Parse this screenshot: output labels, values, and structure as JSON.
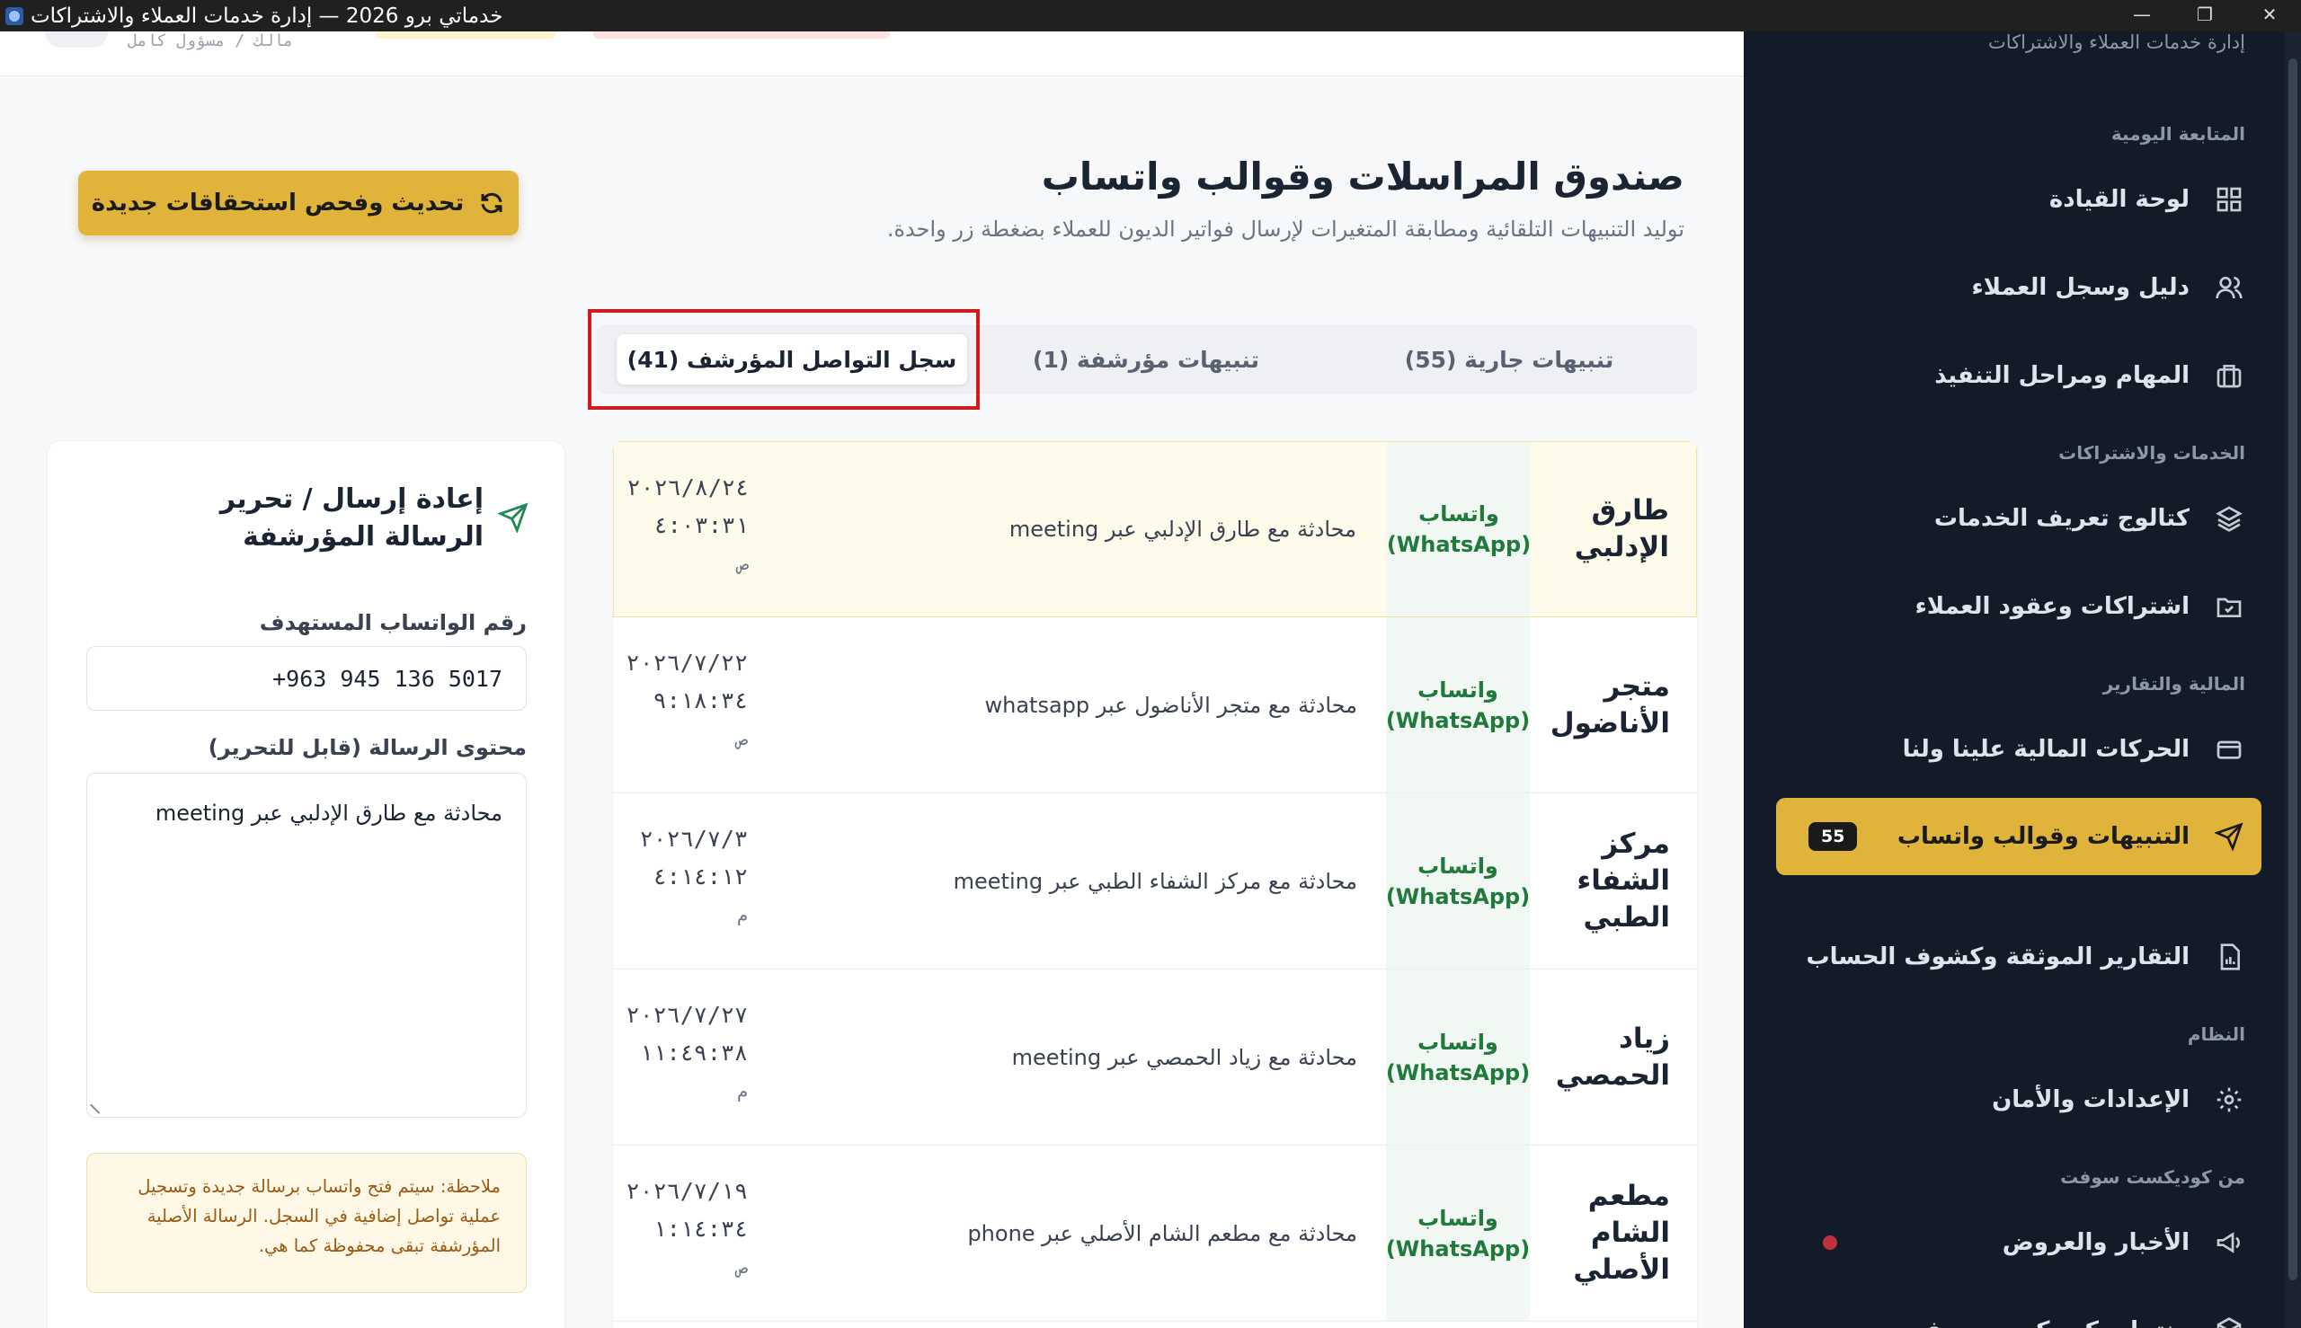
{
  "window": {
    "title": "خدماتي برو 2026 — إدارة خدمات العملاء والاشتراكات",
    "min": "—",
    "max": "❐",
    "close": "✕"
  },
  "topbar": {
    "role": "مالك / مسؤول كامل"
  },
  "sidebar": {
    "brand_sub": "إدارة خدمات العملاء والاشتراكات",
    "sections": {
      "daily": "المتابعة اليومية",
      "services": "الخدمات والاشتراكات",
      "finance": "المالية والتقارير",
      "system": "النظام",
      "vendor": "من كوديكست سوفت"
    },
    "items": [
      {
        "label": "لوحة القيادة",
        "icon": "dashboard-icon"
      },
      {
        "label": "دليل وسجل العملاء",
        "icon": "users-icon"
      },
      {
        "label": "المهام ومراحل التنفيذ",
        "icon": "briefcase-icon"
      },
      {
        "label": "كتالوج تعريف الخدمات",
        "icon": "layers-icon"
      },
      {
        "label": "اشتراكات وعقود العملاء",
        "icon": "folder-check-icon"
      },
      {
        "label": "الحركات المالية علينا ولنا",
        "icon": "card-icon"
      },
      {
        "label": "التنبيهات وقوالب واتساب",
        "icon": "send-icon",
        "badge": "55"
      },
      {
        "label": "التقارير الموثقة وكشوف الحساب",
        "icon": "report-icon"
      },
      {
        "label": "الإعدادات والأمان",
        "icon": "gear-icon"
      },
      {
        "label": "الأخبار والعروض",
        "icon": "megaphone-icon"
      },
      {
        "label": "منتجات كوديكست سوفت",
        "icon": "box-icon"
      }
    ]
  },
  "page": {
    "title": "صندوق المراسلات وقوالب واتساب",
    "subtitle": "توليد التنبيهات التلقائية ومطابقة المتغيرات لإرسال فواتير الديون للعملاء بضغطة زر واحدة.",
    "refresh_label": "تحديث وفحص استحقاقات جديدة"
  },
  "tabs": [
    {
      "label": "تنبيهات جارية (55)"
    },
    {
      "label": "تنبيهات مؤرشفة (1)"
    },
    {
      "label": "سجل التواصل المؤرشف (41)"
    }
  ],
  "log_rows": [
    {
      "name": "طارق الإدلبي",
      "channel": "واتساب (WhatsApp)",
      "summary": "محادثة مع طارق الإدلبي عبر meeting",
      "date": "٢٠٢٦/٨/٢٤",
      "time": "٤:٠٣:٣١",
      "ampm": "ص"
    },
    {
      "name": "متجر الأناضول",
      "channel": "واتساب (WhatsApp)",
      "summary": "محادثة مع متجر الأناضول عبر whatsapp",
      "date": "٢٠٢٦/٧/٢٢",
      "time": "٩:١٨:٣٤",
      "ampm": "ص"
    },
    {
      "name": "مركز الشفاء الطبي",
      "channel": "واتساب (WhatsApp)",
      "summary": "محادثة مع مركز الشفاء الطبي عبر meeting",
      "date": "٢٠٢٦/٧/٣",
      "time": "٤:١٤:١٢",
      "ampm": "م"
    },
    {
      "name": "زياد الحمصي",
      "channel": "واتساب (WhatsApp)",
      "summary": "محادثة مع زياد الحمصي عبر meeting",
      "date": "٢٠٢٦/٧/٢٧",
      "time": "١١:٤٩:٣٨",
      "ampm": "م"
    },
    {
      "name": "مطعم الشام الأصلي",
      "channel": "واتساب (WhatsApp)",
      "summary": "محادثة مع مطعم الشام الأصلي عبر phone",
      "date": "٢٠٢٦/٧/١٩",
      "time": "١:١٤:٣٤",
      "ampm": "ص"
    }
  ],
  "edit": {
    "title": "إعادة إرسال / تحرير الرسالة المؤرشفة",
    "phone_label": "رقم الواتساب المستهدف",
    "phone_value": "+963 945 136 5017",
    "message_label": "محتوى الرسالة (قابل للتحرير)",
    "message_value": "محادثة مع طارق الإدلبي عبر meeting",
    "note": "ملاحظة: سيتم فتح واتساب برسالة جديدة وتسجيل عملية تواصل إضافية في السجل. الرسالة الأصلية المؤرشفة تبقى محفوظة كما هي."
  },
  "colors": {
    "accent": "#e0b43a",
    "sidebar": "#131b28",
    "whatsapp": "#1f7a3c",
    "highlight": "#d21a1a"
  }
}
